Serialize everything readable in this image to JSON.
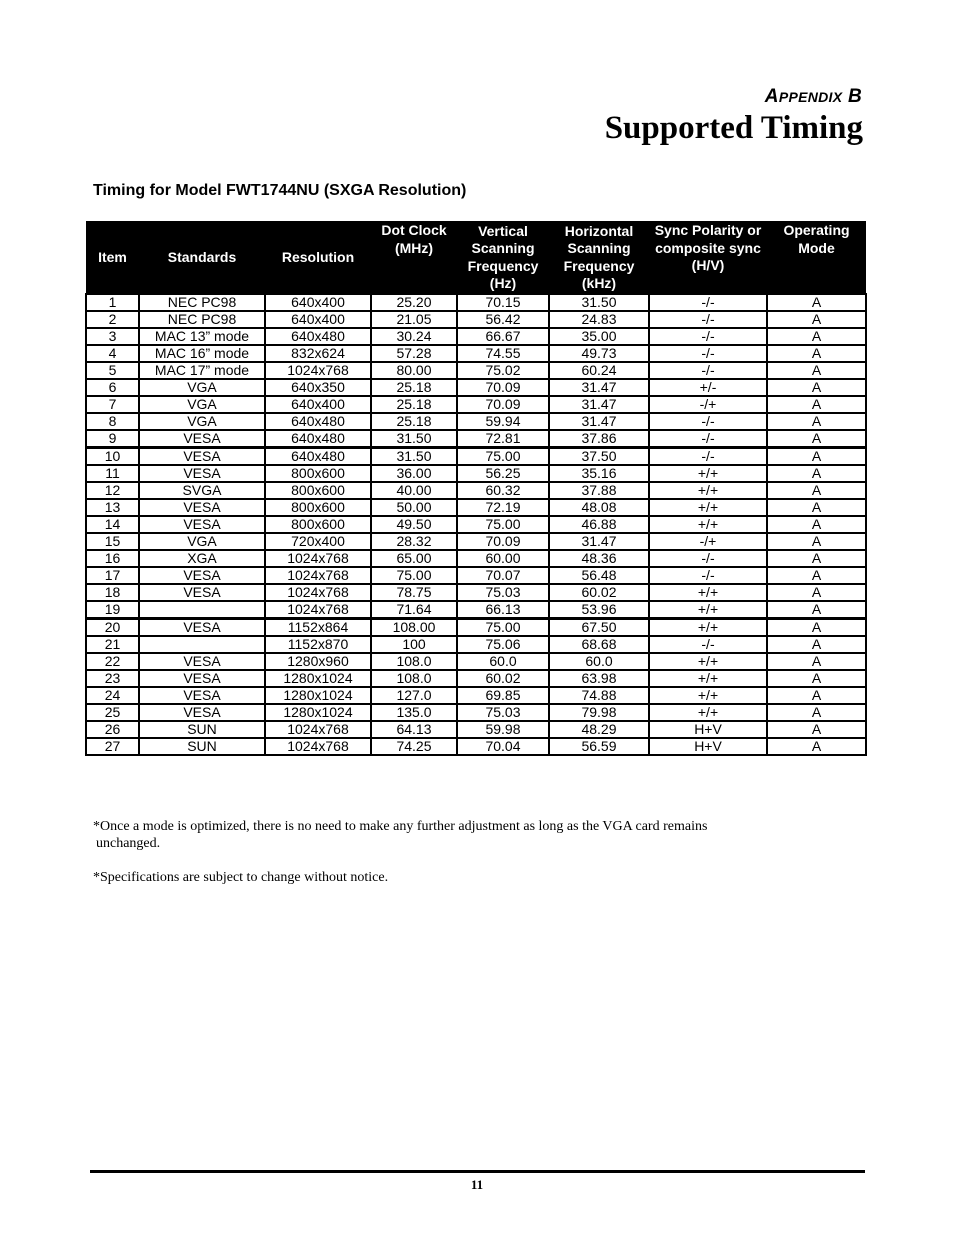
{
  "header": {
    "appendix_first": "A",
    "appendix_rest": "PPENDIX",
    "appendix_letter": "B",
    "title": "Supported Timing"
  },
  "section": {
    "title": "Timing for Model FWT1744NU (SXGA Resolution)"
  },
  "table": {
    "columns": [
      "Item",
      "Standards",
      "Resolution",
      "Dot Clock (MHz)",
      "Vertical Scanning Frequency (Hz)",
      "Horizontal Scanning Frequency (kHz)",
      "Sync Polarity or composite sync (H/V)",
      "Operating Mode"
    ],
    "rows": [
      [
        "1",
        "NEC PC98",
        "640x400",
        "25.20",
        "70.15",
        "31.50",
        "-/-",
        "A"
      ],
      [
        "2",
        "NEC PC98",
        "640x400",
        "21.05",
        "56.42",
        "24.83",
        "-/-",
        "A"
      ],
      [
        "3",
        "MAC 13” mode",
        "640x480",
        "30.24",
        "66.67",
        "35.00",
        "-/-",
        "A"
      ],
      [
        "4",
        "MAC 16” mode",
        "832x624",
        "57.28",
        "74.55",
        "49.73",
        "-/-",
        "A"
      ],
      [
        "5",
        "MAC 17” mode",
        "1024x768",
        "80.00",
        "75.02",
        "60.24",
        "-/-",
        "A"
      ],
      [
        "6",
        "VGA",
        "640x350",
        "25.18",
        "70.09",
        "31.47",
        "+/-",
        "A"
      ],
      [
        "7",
        "VGA",
        "640x400",
        "25.18",
        "70.09",
        "31.47",
        "-/+",
        "A"
      ],
      [
        "8",
        "VGA",
        "640x480",
        "25.18",
        "59.94",
        "31.47",
        "-/-",
        "A"
      ],
      [
        "9",
        "VESA",
        "640x480",
        "31.50",
        "72.81",
        "37.86",
        "-/-",
        "A"
      ],
      [
        "10",
        "VESA",
        "640x480",
        "31.50",
        "75.00",
        "37.50",
        "-/-",
        "A"
      ],
      [
        "11",
        "VESA",
        "800x600",
        "36.00",
        "56.25",
        "35.16",
        "+/+",
        "A"
      ],
      [
        "12",
        "SVGA",
        "800x600",
        "40.00",
        "60.32",
        "37.88",
        "+/+",
        "A"
      ],
      [
        "13",
        "VESA",
        "800x600",
        "50.00",
        "72.19",
        "48.08",
        "+/+",
        "A"
      ],
      [
        "14",
        "VESA",
        "800x600",
        "49.50",
        "75.00",
        "46.88",
        "+/+",
        "A"
      ],
      [
        "15",
        "VGA",
        "720x400",
        "28.32",
        "70.09",
        "31.47",
        "-/+",
        "A"
      ],
      [
        "16",
        "XGA",
        "1024x768",
        "65.00",
        "60.00",
        "48.36",
        "-/-",
        "A"
      ],
      [
        "17",
        "VESA",
        "1024x768",
        "75.00",
        "70.07",
        "56.48",
        "-/-",
        "A"
      ],
      [
        "18",
        "VESA",
        "1024x768",
        "78.75",
        "75.03",
        "60.02",
        "+/+",
        "A"
      ],
      [
        "19",
        "",
        "1024x768",
        "71.64",
        "66.13",
        "53.96",
        "+/+",
        "A"
      ],
      [
        "20",
        "VESA",
        "1152x864",
        "108.00",
        "75.00",
        "67.50",
        "+/+",
        "A"
      ],
      [
        "21",
        "",
        "1152x870",
        "100",
        "75.06",
        "68.68",
        "-/-",
        "A"
      ],
      [
        "22",
        "VESA",
        "1280x960",
        "108.0",
        "60.0",
        "60.0",
        "+/+",
        "A"
      ],
      [
        "23",
        "VESA",
        "1280x1024",
        "108.0",
        "60.02",
        "63.98",
        "+/+",
        "A"
      ],
      [
        "24",
        "VESA",
        "1280x1024",
        "127.0",
        "69.85",
        "74.88",
        "+/+",
        "A"
      ],
      [
        "25",
        "VESA",
        "1280x1024",
        "135.0",
        "75.03",
        "79.98",
        "+/+",
        "A"
      ],
      [
        "26",
        "SUN",
        "1024x768",
        "64.13",
        "59.98",
        "48.29",
        "H+V",
        "A"
      ],
      [
        "27",
        "SUN",
        "1024x768",
        "74.25",
        "70.04",
        "56.59",
        "H+V",
        "A"
      ]
    ]
  },
  "notes": {
    "note1_line1": "*Once a mode is optimized, there is no need to make any further adjustment as long as the VGA card remains",
    "note1_line2": "unchanged.",
    "note2": "*Specifications are subject to change without notice."
  },
  "footer": {
    "page_number": "11"
  }
}
